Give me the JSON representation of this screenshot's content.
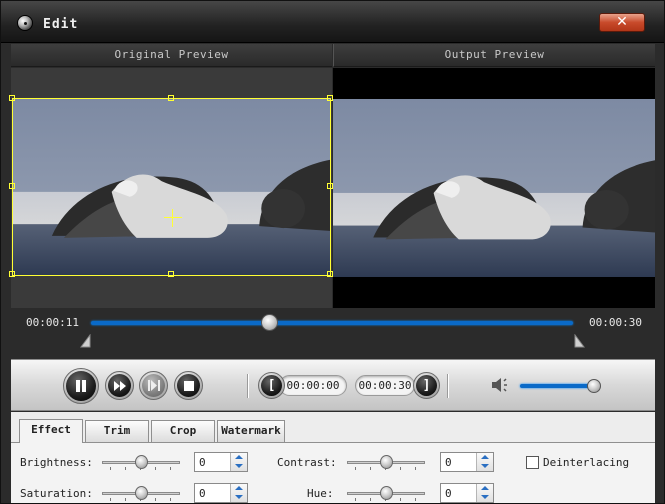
{
  "window": {
    "title": "Edit",
    "close_label": "✕"
  },
  "preview": {
    "original_label": "Original Preview",
    "output_label": "Output Preview"
  },
  "timeline": {
    "current_time": "00:00:11",
    "end_time": "00:00:30",
    "position_fraction": 0.37
  },
  "controls": {
    "trim_start_time": "00:00:00",
    "trim_end_time": "00:00:30",
    "trim_start_glyph": "[",
    "trim_end_glyph": "]",
    "volume_fraction": 0.95
  },
  "tabs": [
    {
      "label": "Effect",
      "active": true
    },
    {
      "label": "Trim",
      "active": false
    },
    {
      "label": "Crop",
      "active": false
    },
    {
      "label": "Watermark",
      "active": false
    }
  ],
  "effect": {
    "brightness": {
      "label": "Brightness:",
      "value": "0"
    },
    "saturation": {
      "label": "Saturation:",
      "value": "0"
    },
    "contrast": {
      "label": "Contrast:",
      "value": "0"
    },
    "hue": {
      "label": "Hue:",
      "value": "0"
    },
    "deinterlacing": {
      "label": "Deinterlacing",
      "checked": false
    }
  },
  "icons": {
    "app": "film-reel-icon",
    "close": "close-icon",
    "play_pause": "pause-icon",
    "fast_forward": "fast-forward-icon",
    "next_frame": "next-frame-icon",
    "stop": "stop-icon",
    "volume": "volume-icon"
  },
  "colors": {
    "accent": "#0a6ac8",
    "crop_border": "#ffff33",
    "close_button": "#c84a2b"
  }
}
